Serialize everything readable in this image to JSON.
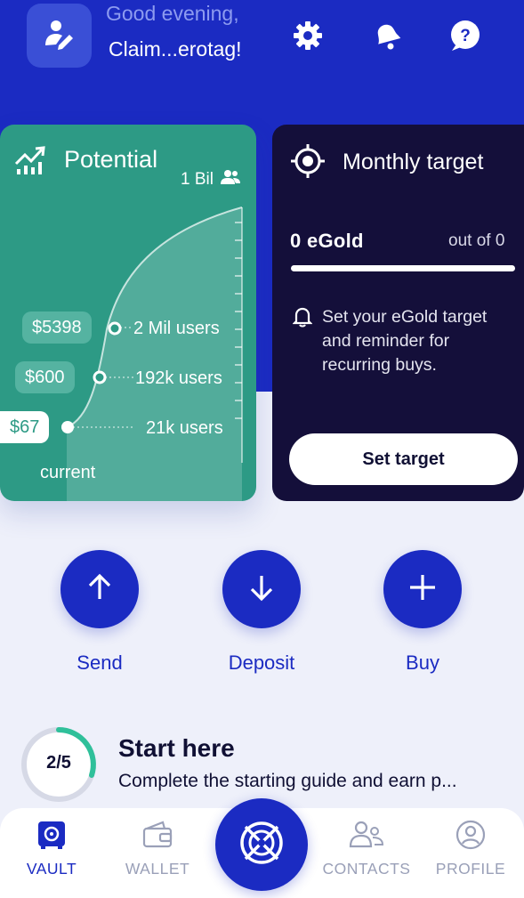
{
  "header": {
    "greeting": "Good evening,",
    "username": "Claim...erotag!",
    "icons": [
      "edit-profile-icon",
      "gear-icon",
      "bell-icon",
      "help-icon"
    ]
  },
  "potential": {
    "title": "Potential",
    "total_users": "1 Bil",
    "tiers": [
      {
        "price": "$5398",
        "users": "2 Mil users"
      },
      {
        "price": "$600",
        "users": "192k users"
      },
      {
        "price": "$67",
        "users": "21k users"
      }
    ],
    "current_label": "current"
  },
  "monthly_target": {
    "title": "Monthly target",
    "amount": "0 eGold",
    "out_of": "out of 0",
    "progress": 0,
    "message": "Set your eGold target and reminder for recurring buys.",
    "button_label": "Set target"
  },
  "actions": [
    {
      "label": "Send",
      "icon": "arrow-up-icon"
    },
    {
      "label": "Deposit",
      "icon": "arrow-down-icon"
    },
    {
      "label": "Buy",
      "icon": "plus-icon"
    }
  ],
  "start_here": {
    "progress_text": "2/5",
    "progress_fraction": 0.4,
    "title": "Start here",
    "subtitle": "Complete the starting guide and earn p..."
  },
  "nav": {
    "items": [
      {
        "label": "VAULT",
        "icon": "vault-icon",
        "active": true
      },
      {
        "label": "WALLET",
        "icon": "wallet-icon",
        "active": false
      },
      {
        "label": "CONTACTS",
        "icon": "contacts-icon",
        "active": false
      },
      {
        "label": "PROFILE",
        "icon": "profile-icon",
        "active": false
      }
    ],
    "center_icon": "egold-logo-icon"
  },
  "colors": {
    "brand_blue": "#1b2bc2",
    "potential_green": "#2d9a85",
    "target_dark": "#140f3a",
    "nav_inactive": "#9aa0b8"
  }
}
